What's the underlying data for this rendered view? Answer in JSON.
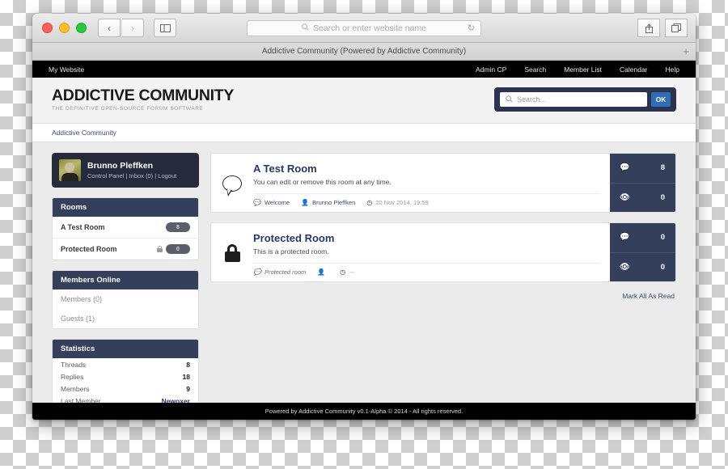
{
  "browser": {
    "address_placeholder": "Search or enter website name",
    "tab_title": "Addictive Community (Powered by Addictive Community)",
    "new_tab_label": "+",
    "back_icon": "‹",
    "forward_icon": "›",
    "sidebar_icon": "▣",
    "reload_icon": "↻",
    "share_icon": "⇧",
    "tabs_icon": "⧉",
    "search_icon": "⚲"
  },
  "topnav": {
    "site_label": "My Website",
    "links": [
      "Admin CP",
      "Search",
      "Member List",
      "Calendar",
      "Help"
    ]
  },
  "header": {
    "logo_title": "ADDICTIVE COMMUNITY",
    "logo_subtitle": "THE DEFINITIVE OPEN-SOURCE FORUM SOFTWARE",
    "search_placeholder": "Search...",
    "search_value": "",
    "search_button": "OK",
    "accent_navy": "#2b3350",
    "accent_blue": "#2f6db5"
  },
  "breadcrumb": {
    "items": [
      "Addictive Community"
    ]
  },
  "sidebar": {
    "user": {
      "name": "Brunno Pleffken",
      "links": "Control Panel | Inbox (0) | Logout"
    },
    "rooms_panel": {
      "title": "Rooms",
      "rooms": [
        {
          "name": "A Test Room",
          "count": "8",
          "locked": false
        },
        {
          "name": "Protected Room",
          "count": "0",
          "locked": true
        }
      ]
    },
    "members_panel": {
      "title": "Members Online",
      "rows": [
        "Members (0)",
        "Guests (1)"
      ]
    },
    "statistics_panel": {
      "title": "Statistics",
      "rows": [
        {
          "label": "Threads",
          "value": "8",
          "link": false
        },
        {
          "label": "Replies",
          "value": "18",
          "link": false
        },
        {
          "label": "Members",
          "value": "9",
          "link": false
        },
        {
          "label": "Last Member",
          "value": "Newoxer",
          "link": true
        }
      ]
    }
  },
  "main": {
    "rooms": [
      {
        "icon": "speech-bubble",
        "title": "A Test Room",
        "description": "You can edit or remove this room at any time.",
        "meta": {
          "thread": "Welcome",
          "author": "Brunno Pleffken",
          "date": "20 Nov 2014, 19:59"
        },
        "stats": {
          "threads": "8",
          "views": "0"
        }
      },
      {
        "icon": "lock",
        "title": "Protected Room",
        "description": "This is a protected room.",
        "meta": {
          "thread": "Protected room",
          "author": "",
          "date": "---"
        },
        "stats": {
          "threads": "0",
          "views": "0"
        }
      }
    ],
    "mark_all_read": "Mark All As Read"
  },
  "footer": {
    "text": "Powered by Addictive Community v0.1-Alpha © 2014 - All rights reserved."
  }
}
